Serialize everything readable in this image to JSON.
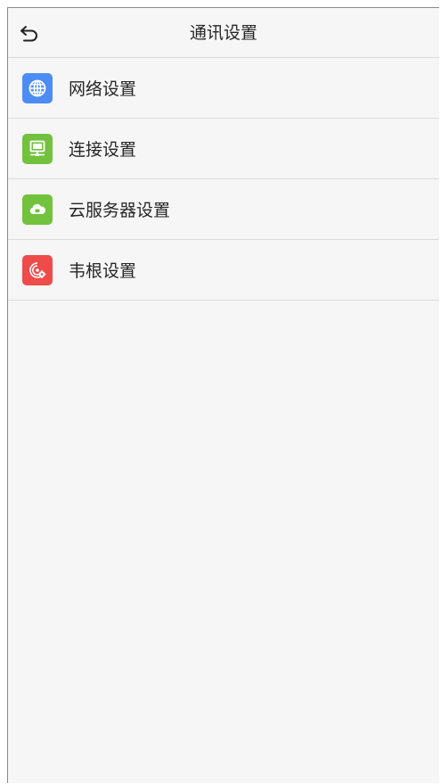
{
  "header": {
    "title": "通讯设置",
    "back_icon": "back-arrow-icon"
  },
  "menu": {
    "items": [
      {
        "label": "网络设置",
        "icon": "globe-icon",
        "color": "#4d8cf5"
      },
      {
        "label": "连接设置",
        "icon": "monitor-connection-icon",
        "color": "#72c23e"
      },
      {
        "label": "云服务器设置",
        "icon": "cloud-icon",
        "color": "#72c23e"
      },
      {
        "label": "韦根设置",
        "icon": "wiegand-signal-gear-icon",
        "color": "#ef4b4b"
      }
    ]
  },
  "colors": {
    "background": "#f6f6f6",
    "divider": "#dcdcdc",
    "text": "#262626"
  }
}
